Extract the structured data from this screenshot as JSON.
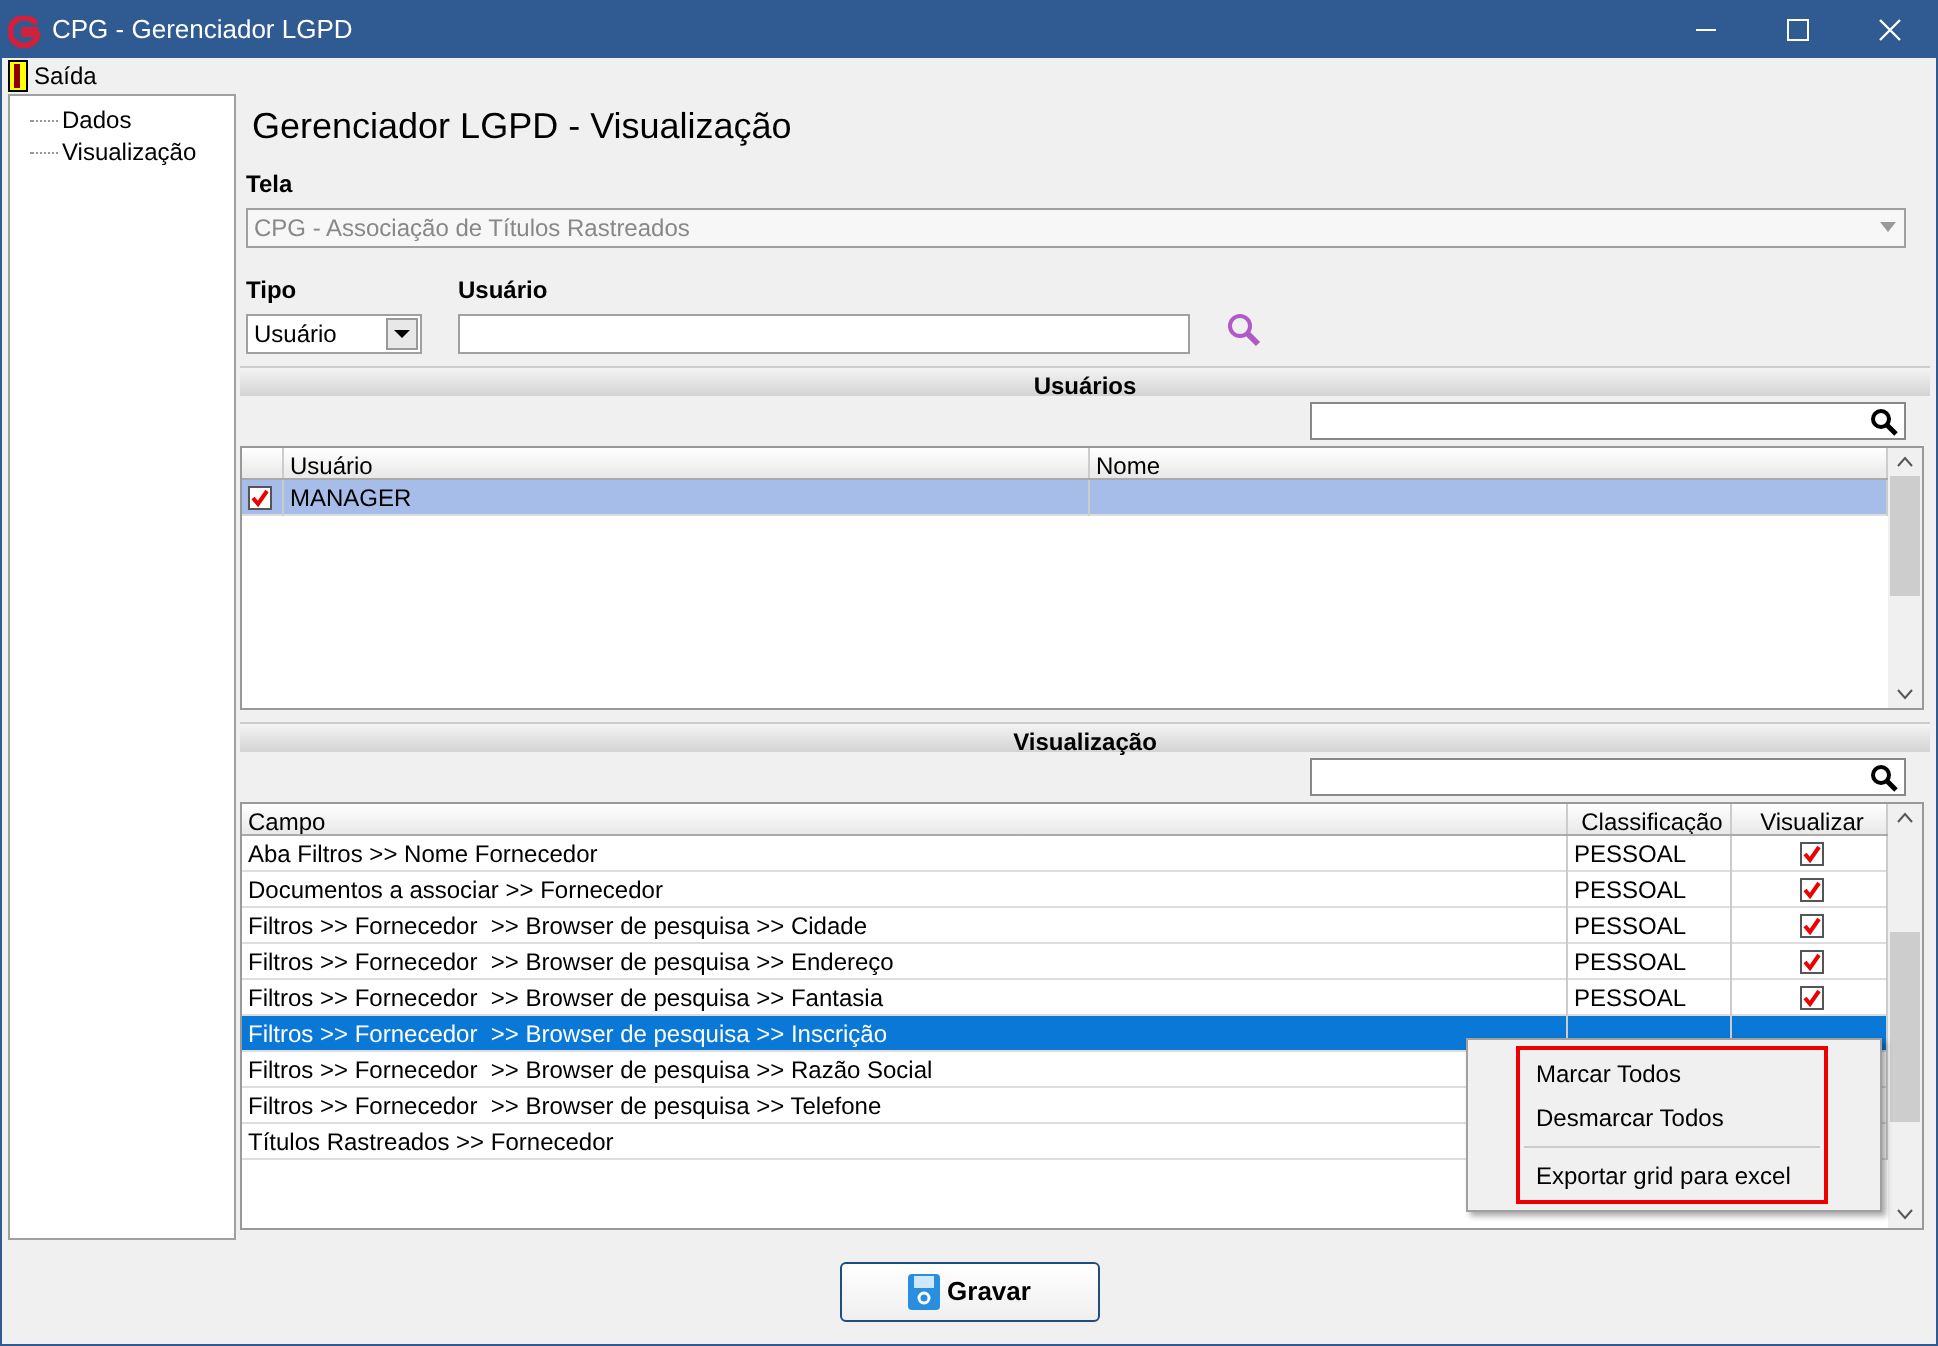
{
  "window": {
    "title": "CPG - Gerenciador LGPD"
  },
  "menu": [
    {
      "label": "Saída"
    }
  ],
  "sidebar": {
    "items": [
      {
        "label": "Dados",
        "selected": false
      },
      {
        "label": "Visualização",
        "selected": false
      }
    ]
  },
  "heading": "Gerenciador LGPD - Visualização",
  "tela": {
    "label": "Tela",
    "value": "CPG - Associação de Títulos Rastreados",
    "disabled": true
  },
  "tipo": {
    "label": "Tipo",
    "value": "Usuário"
  },
  "usuario": {
    "label": "Usuário"
  },
  "usuarios_section": {
    "title": "Usuários",
    "columns": [
      "Usuário",
      "Nome"
    ],
    "rows": [
      {
        "usuario": "MANAGER",
        "checked": true,
        "selected": true
      }
    ]
  },
  "visualizacao_section": {
    "title": "Visualização",
    "columns": [
      "Campo",
      "Classificação",
      "Visualizar"
    ],
    "rows": [
      {
        "campo": "Aba Filtros >> Nome Fornecedor",
        "classificacao": "PESSOAL",
        "visualizar": true,
        "selected": false
      },
      {
        "campo": "Documentos a associar >> Fornecedor",
        "classificacao": "PESSOAL",
        "visualizar": true,
        "selected": false
      },
      {
        "campo": "Filtros >> Fornecedor  >> Browser de pesquisa >> Cidade",
        "classificacao": "PESSOAL",
        "visualizar": true,
        "selected": false
      },
      {
        "campo": "Filtros >> Fornecedor  >> Browser de pesquisa >> Endereço",
        "classificacao": "PESSOAL",
        "visualizar": true,
        "selected": false
      },
      {
        "campo": "Filtros >> Fornecedor  >> Browser de pesquisa >> Fantasia",
        "classificacao": "PESSOAL",
        "visualizar": true,
        "selected": false
      },
      {
        "campo": "Filtros >> Fornecedor  >> Browser de pesquisa >> Inscrição",
        "selected": true
      },
      {
        "campo": "Filtros >> Fornecedor  >> Browser de pesquisa >> Razão Social",
        "selected": false
      },
      {
        "campo": "Filtros >> Fornecedor  >> Browser de pesquisa >> Telefone",
        "selected": false
      },
      {
        "campo": "Títulos Rastreados >> Fornecedor",
        "selected": false
      }
    ]
  },
  "context_menu": {
    "items": [
      {
        "label": "Marcar Todos",
        "kind": "item"
      },
      {
        "label": "Desmarcar Todos",
        "kind": "item"
      },
      {
        "kind": "separator"
      },
      {
        "label": "Exportar grid para excel",
        "kind": "item"
      }
    ]
  },
  "save_button": {
    "label": "Gravar"
  }
}
